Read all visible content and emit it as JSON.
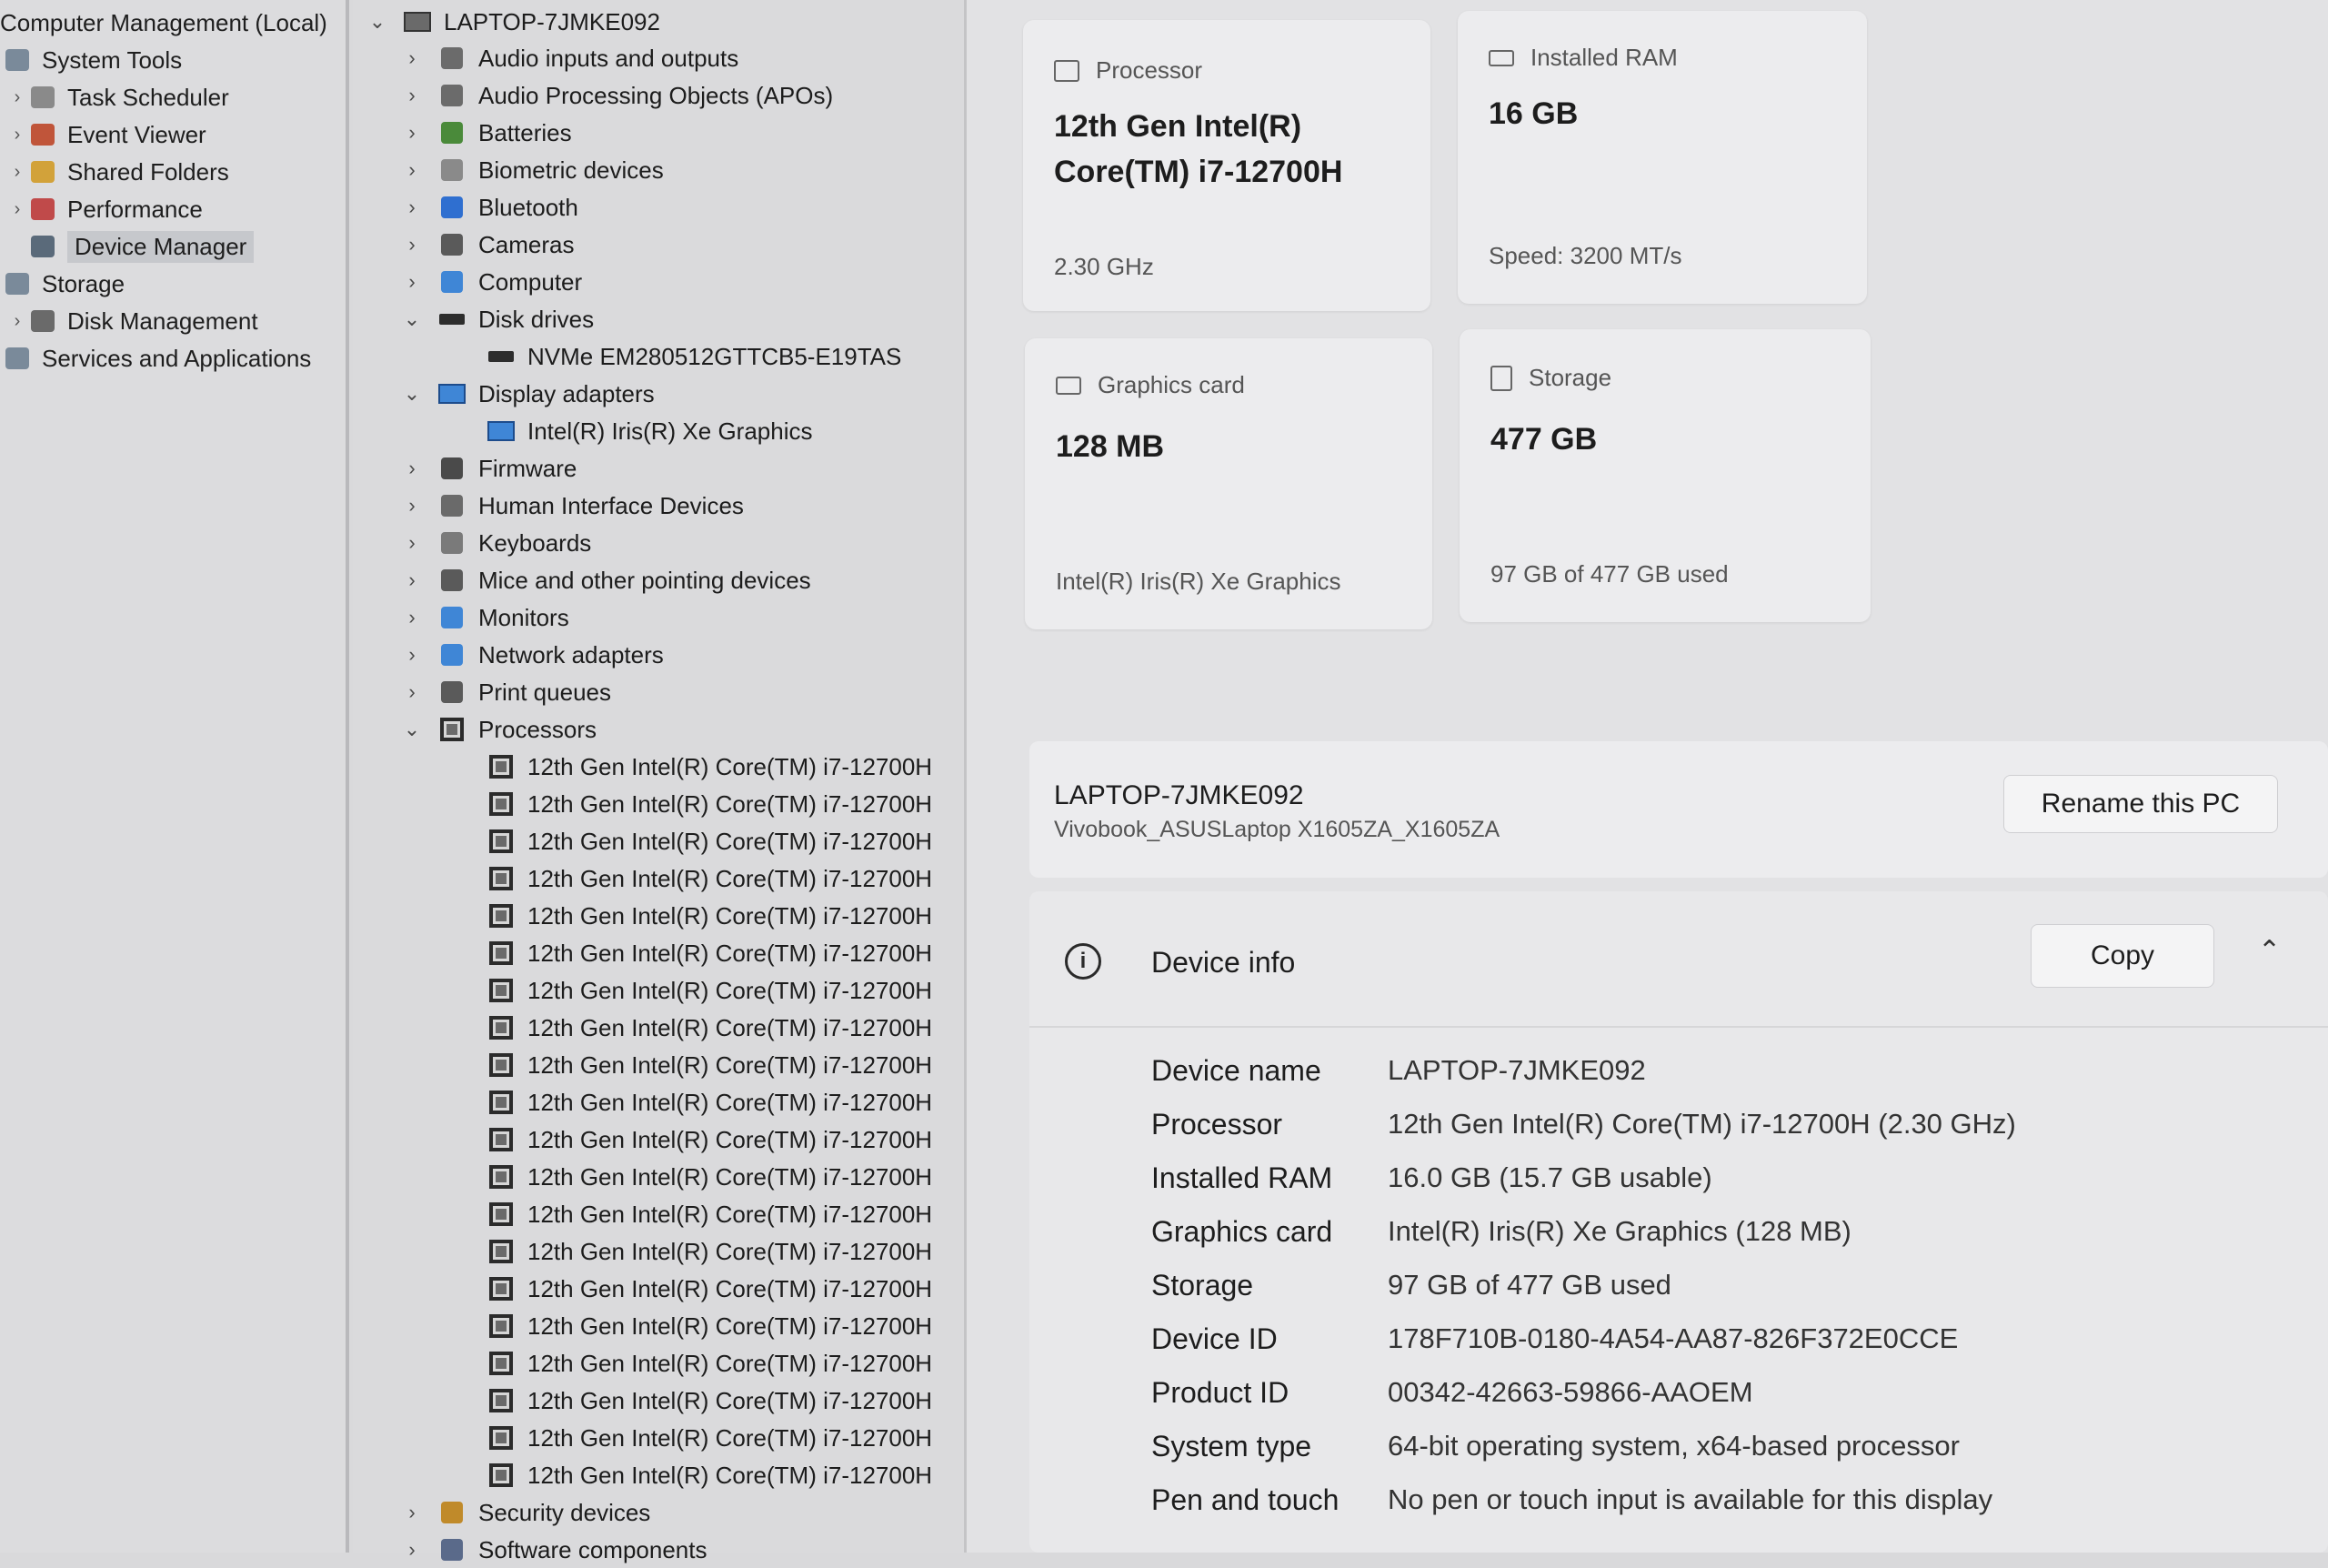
{
  "nav": {
    "root": "Computer Management (Local)",
    "items": [
      {
        "label": "System Tools",
        "icon": "tools-icon",
        "color": "#7a8a9a",
        "expanded": true,
        "level": 0
      },
      {
        "label": "Task Scheduler",
        "icon": "clock-icon",
        "color": "#8a8a8a",
        "level": 1
      },
      {
        "label": "Event Viewer",
        "icon": "event-viewer-icon",
        "color": "#c0553a",
        "level": 1
      },
      {
        "label": "Shared Folders",
        "icon": "shared-folder-icon",
        "color": "#d2a23a",
        "level": 1
      },
      {
        "label": "Performance",
        "icon": "performance-icon",
        "color": "#c04a4a",
        "level": 1
      },
      {
        "label": "Device Manager",
        "icon": "device-manager-icon",
        "color": "#5a6a7a",
        "level": 1,
        "selected": true
      },
      {
        "label": "Storage",
        "icon": "storage-icon",
        "color": "#7a8a9a",
        "expanded": true,
        "level": 0
      },
      {
        "label": "Disk Management",
        "icon": "disk-management-icon",
        "color": "#6a6a6a",
        "level": 1
      },
      {
        "label": "Services and Applications",
        "icon": "services-icon",
        "color": "#7a8a9a",
        "level": 0
      }
    ]
  },
  "tree": {
    "root": "LAPTOP-7JMKE092",
    "categories_top": [
      {
        "label": "Audio inputs and outputs",
        "icon": "speaker-icon",
        "color": "#6b6b6b"
      },
      {
        "label": "Audio Processing Objects (APOs)",
        "icon": "speaker-icon",
        "color": "#6b6b6b"
      },
      {
        "label": "Batteries",
        "icon": "battery-icon",
        "color": "#4a8a3a"
      },
      {
        "label": "Biometric devices",
        "icon": "biometric-icon",
        "color": "#8a8a8a"
      },
      {
        "label": "Bluetooth",
        "icon": "bluetooth-icon",
        "color": "#2f6fd0"
      },
      {
        "label": "Cameras",
        "icon": "camera-icon",
        "color": "#5a5a5a"
      },
      {
        "label": "Computer",
        "icon": "computer-icon",
        "color": "#3f86d6"
      }
    ],
    "disk_drives": {
      "label": "Disk drives",
      "child": "NVMe EM280512GTTCB5-E19TAS"
    },
    "display_adapters": {
      "label": "Display adapters",
      "child": "Intel(R) Iris(R) Xe Graphics"
    },
    "categories_mid": [
      {
        "label": "Firmware",
        "icon": "firmware-icon",
        "color": "#4a4a4a"
      },
      {
        "label": "Human Interface Devices",
        "icon": "hid-icon",
        "color": "#6a6a6a"
      },
      {
        "label": "Keyboards",
        "icon": "keyboard-icon",
        "color": "#7a7a7a"
      },
      {
        "label": "Mice and other pointing devices",
        "icon": "mouse-icon",
        "color": "#5a5a5a"
      },
      {
        "label": "Monitors",
        "icon": "monitor-icon",
        "color": "#3f86d6"
      },
      {
        "label": "Network adapters",
        "icon": "network-adapter-icon",
        "color": "#3f86d6"
      },
      {
        "label": "Print queues",
        "icon": "printer-icon",
        "color": "#5a5a5a"
      }
    ],
    "processors": {
      "label": "Processors",
      "children": [
        "12th Gen Intel(R) Core(TM) i7-12700H",
        "12th Gen Intel(R) Core(TM) i7-12700H",
        "12th Gen Intel(R) Core(TM) i7-12700H",
        "12th Gen Intel(R) Core(TM) i7-12700H",
        "12th Gen Intel(R) Core(TM) i7-12700H",
        "12th Gen Intel(R) Core(TM) i7-12700H",
        "12th Gen Intel(R) Core(TM) i7-12700H",
        "12th Gen Intel(R) Core(TM) i7-12700H",
        "12th Gen Intel(R) Core(TM) i7-12700H",
        "12th Gen Intel(R) Core(TM) i7-12700H",
        "12th Gen Intel(R) Core(TM) i7-12700H",
        "12th Gen Intel(R) Core(TM) i7-12700H",
        "12th Gen Intel(R) Core(TM) i7-12700H",
        "12th Gen Intel(R) Core(TM) i7-12700H",
        "12th Gen Intel(R) Core(TM) i7-12700H",
        "12th Gen Intel(R) Core(TM) i7-12700H",
        "12th Gen Intel(R) Core(TM) i7-12700H",
        "12th Gen Intel(R) Core(TM) i7-12700H",
        "12th Gen Intel(R) Core(TM) i7-12700H",
        "12th Gen Intel(R) Core(TM) i7-12700H"
      ]
    },
    "categories_bottom": [
      {
        "label": "Security devices",
        "icon": "security-icon",
        "color": "#c08a2a"
      },
      {
        "label": "Software components",
        "icon": "software-icon",
        "color": "#5a6a8a"
      }
    ]
  },
  "cards": {
    "processor": {
      "title": "Processor",
      "value_line1": "12th Gen Intel(R)",
      "value_line2": "Core(TM) i7-12700H",
      "sub": "2.30 GHz"
    },
    "ram": {
      "title": "Installed RAM",
      "value": "16 GB",
      "sub": "Speed: 3200 MT/s"
    },
    "graphics": {
      "title": "Graphics card",
      "value": "128 MB",
      "sub": "Intel(R) Iris(R) Xe Graphics"
    },
    "storage": {
      "title": "Storage",
      "value": "477 GB",
      "sub": "97 GB of 477 GB used"
    }
  },
  "pc": {
    "name": "LAPTOP-7JMKE092",
    "model": "Vivobook_ASUSLaptop X1605ZA_X1605ZA",
    "rename_label": "Rename this PC"
  },
  "device_info": {
    "title": "Device info",
    "copy_label": "Copy",
    "rows": [
      {
        "label": "Device name",
        "value": "LAPTOP-7JMKE092"
      },
      {
        "label": "Processor",
        "value": "12th Gen Intel(R) Core(TM) i7-12700H (2.30 GHz)"
      },
      {
        "label": "Installed RAM",
        "value": "16.0 GB (15.7 GB usable)"
      },
      {
        "label": "Graphics card",
        "value": "Intel(R) Iris(R) Xe Graphics (128 MB)"
      },
      {
        "label": "Storage",
        "value": "97 GB of 477 GB used"
      },
      {
        "label": "Device ID",
        "value": "178F710B-0180-4A54-AA87-826F372E0CCE"
      },
      {
        "label": "Product ID",
        "value": "00342-42663-59866-AAOEM"
      },
      {
        "label": "System type",
        "value": "64-bit operating system, x64-based processor"
      },
      {
        "label": "Pen and touch",
        "value": "No pen or touch input is available for this display"
      }
    ]
  }
}
